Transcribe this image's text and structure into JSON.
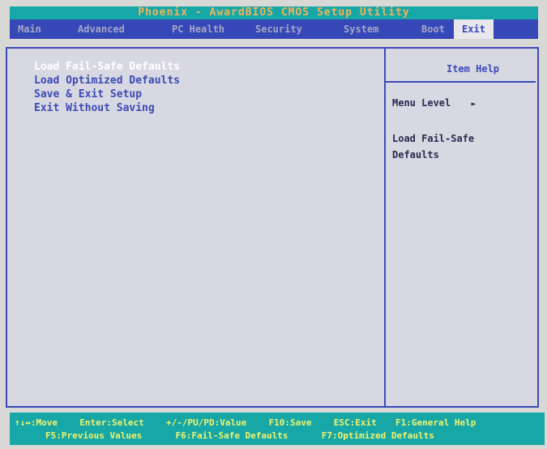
{
  "title": "Phoenix - AwardBIOS CMOS Setup Utility",
  "tabs": [
    {
      "label": "Main",
      "active": false
    },
    {
      "label": "Advanced",
      "active": false
    },
    {
      "label": "PC Health",
      "active": false
    },
    {
      "label": "Security",
      "active": false
    },
    {
      "label": "System",
      "active": false
    },
    {
      "label": "Boot",
      "active": false
    },
    {
      "label": "Exit",
      "active": true
    }
  ],
  "menu_items": [
    {
      "label": "Load Fail-Safe Defaults",
      "selected": true
    },
    {
      "label": "Load Optimized Defaults",
      "selected": false
    },
    {
      "label": "Save & Exit Setup",
      "selected": false
    },
    {
      "label": "Exit Without Saving",
      "selected": false
    }
  ],
  "help": {
    "title": "Item Help",
    "menu_level_label": "Menu Level",
    "menu_level_arrow": "►",
    "description_line1": "Load Fail-Safe",
    "description_line2": "Defaults"
  },
  "status": {
    "line1": [
      {
        "key": "↑↓↔:Move",
        "text": ""
      },
      {
        "key": "Enter:Select",
        "text": ""
      },
      {
        "key": "+/-/PU/PD:Value",
        "text": ""
      },
      {
        "key": "F10:Save",
        "text": ""
      },
      {
        "key": "ESC:Exit",
        "text": ""
      },
      {
        "key": "F1:General Help",
        "text": ""
      }
    ],
    "line2": [
      {
        "key": "F5:Previous Values",
        "text": ""
      },
      {
        "key": "F6:Fail-Safe Defaults",
        "text": ""
      },
      {
        "key": "F7:Optimized Defaults",
        "text": ""
      }
    ]
  },
  "colors": {
    "accent_blue": "#3647b8",
    "cyan": "#16a7a6",
    "background": "#d8d8e2",
    "selected_text": "#ffffff"
  }
}
